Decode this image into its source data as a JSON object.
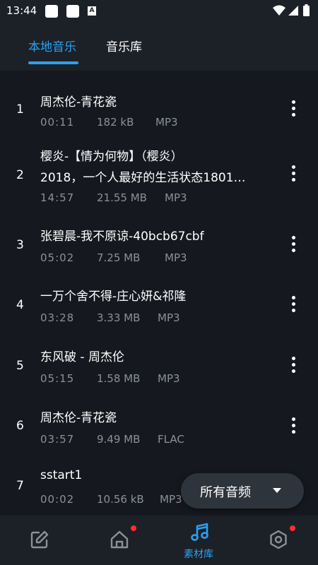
{
  "status_bar": {
    "time": "13:44"
  },
  "tabs": [
    {
      "label": "本地音乐",
      "active": true
    },
    {
      "label": "音乐库",
      "active": false
    }
  ],
  "songs": [
    {
      "index": "1",
      "title": "周杰伦-青花瓷",
      "duration": "00:11",
      "size": "182 kB",
      "format": "MP3"
    },
    {
      "index": "2",
      "title_line1": "樱炎-【情为何物】（樱炎）",
      "title_line2": "2018，一个人最好的生活状态1801…",
      "duration": "14:57",
      "size": "21.55 MB",
      "format": "MP3"
    },
    {
      "index": "3",
      "title": "张碧晨-我不原谅-40bcb67cbf",
      "duration": "05:02",
      "size": "7.25 MB",
      "format": "MP3"
    },
    {
      "index": "4",
      "title": "一万个舍不得-庄心妍&祁隆",
      "duration": "03:28",
      "size": "3.33 MB",
      "format": "MP3"
    },
    {
      "index": "5",
      "title": "东风破 - 周杰伦",
      "duration": "05:15",
      "size": "1.58 MB",
      "format": "MP3"
    },
    {
      "index": "6",
      "title": "周杰伦-青花瓷",
      "duration": "03:57",
      "size": "9.49 MB",
      "format": "FLAC"
    },
    {
      "index": "7",
      "title": "sstart1",
      "duration": "00:02",
      "size": "10.56 kB",
      "format": "MP3"
    }
  ],
  "filter": {
    "label": "所有音频",
    "icon": "caret-down-icon"
  },
  "bottom_nav": [
    {
      "icon": "edit-icon",
      "label": "",
      "badge": false
    },
    {
      "icon": "home-icon",
      "label": "",
      "badge": true
    },
    {
      "icon": "music-note-icon",
      "label": "素材库",
      "badge": false,
      "active": true
    },
    {
      "icon": "settings-hex-icon",
      "label": "",
      "badge": true
    }
  ],
  "colors": {
    "accent": "#2aa1f2",
    "background": "#15191f",
    "bar_background": "#1c2128",
    "secondary_text": "#8c9196",
    "badge": "#ff2d2d"
  }
}
